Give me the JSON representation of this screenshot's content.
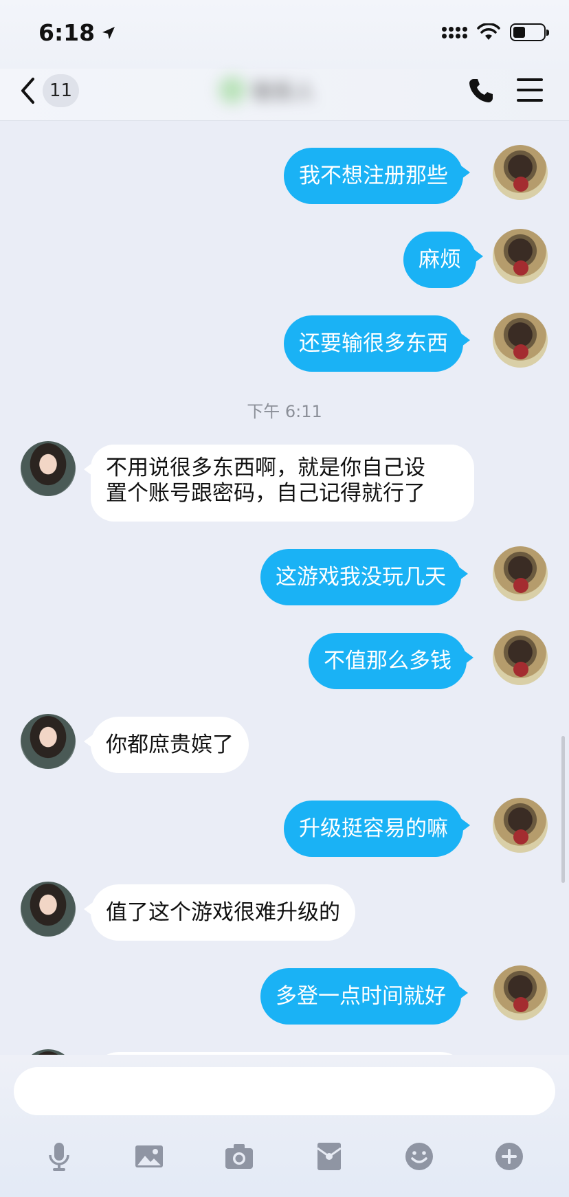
{
  "status_bar": {
    "time": "6:18"
  },
  "nav": {
    "unread_count": "11",
    "contact_name": "联系人"
  },
  "messages": [
    {
      "from": "me",
      "text": "我不想注册那些"
    },
    {
      "from": "me",
      "text": "麻烦"
    },
    {
      "from": "me",
      "text": "还要输很多东西"
    },
    {
      "type": "timestamp",
      "text": "下午 6:11"
    },
    {
      "from": "them",
      "lines": [
        "不用说很多东西啊，就是你自己设",
        "置个账号跟密码，自己记得就行了"
      ]
    },
    {
      "from": "me",
      "text": "这游戏我没玩几天"
    },
    {
      "from": "me",
      "text": "不值那么多钱"
    },
    {
      "from": "them",
      "text": "你都庶贵嫔了"
    },
    {
      "from": "me",
      "text": "升级挺容易的嘛"
    },
    {
      "from": "them",
      "text": "值了这个游戏很难升级的"
    },
    {
      "from": "me",
      "text": "多登一点时间就好"
    }
  ],
  "input": {
    "placeholder": ""
  },
  "toolbar": [
    "microphone-icon",
    "image-icon",
    "camera-icon",
    "red-packet-icon",
    "emoji-icon",
    "plus-icon"
  ],
  "colors": {
    "bubble_me": "#1ab2f5",
    "bubble_them": "#ffffff",
    "background": "#eaedf6",
    "toolbar_icon": "#8f95a3"
  }
}
